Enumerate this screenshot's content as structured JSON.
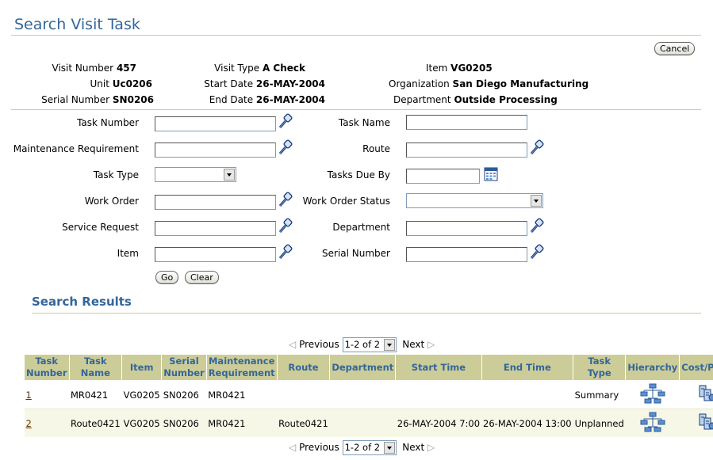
{
  "page": {
    "title": "Search Visit Task"
  },
  "buttons": {
    "cancel": "Cancel",
    "go": "Go",
    "clear": "Clear"
  },
  "header": {
    "visit_number_label": "Visit Number",
    "visit_number": "457",
    "unit_label": "Unit",
    "unit": "Uc0206",
    "serial_number_label": "Serial Number",
    "serial_number": "SN0206",
    "visit_type_label": "Visit Type",
    "visit_type": "A Check",
    "start_date_label": "Start Date",
    "start_date": "26-MAY-2004",
    "end_date_label": "End Date",
    "end_date": "26-MAY-2004",
    "item_label": "Item",
    "item": "VG0205",
    "organization_label": "Organization",
    "organization": "San Diego Manufacturing",
    "department_label": "Department",
    "department": "Outside Processing"
  },
  "form": {
    "task_number": "Task Number",
    "maintenance_requirement": "Maintenance Requirement",
    "task_type": "Task Type",
    "work_order": "Work Order",
    "service_request": "Service Request",
    "item": "Item",
    "task_name": "Task Name",
    "route": "Route",
    "tasks_due_by": "Tasks Due By",
    "work_order_status": "Work Order Status",
    "department": "Department",
    "serial_number": "Serial Number"
  },
  "results": {
    "title": "Search Results",
    "previous": "Previous",
    "next": "Next",
    "range": "1-2 of 2",
    "columns": {
      "task_number": "Task Number",
      "task_name": "Task Name",
      "item": "Item",
      "serial_number": "Serial Number",
      "maintenance_requirement": "Maintenance Requirement",
      "route": "Route",
      "department": "Department",
      "start_time": "Start Time",
      "end_time": "End Time",
      "task_type": "Task Type",
      "hierarchy": "Hierarchy",
      "cost_price": "Cost/Price"
    },
    "rows": [
      {
        "task_number": "1",
        "task_name": "MR0421",
        "item": "VG0205",
        "serial_number": "SN0206",
        "mr": "MR0421",
        "route": "",
        "department": "",
        "start_time": "",
        "end_time": "",
        "task_type": "Summary"
      },
      {
        "task_number": "2",
        "task_name": "Route0421",
        "item": "VG0205",
        "serial_number": "SN0206",
        "mr": "MR0421",
        "route": "Route0421",
        "department": "",
        "start_time": "26-MAY-2004 7:00",
        "end_time": "26-MAY-2004 13:00",
        "task_type": "Unplanned"
      }
    ]
  },
  "icons": {
    "search": "flashlight-search-icon",
    "calendar": "calendar-icon",
    "hierarchy": "hierarchy-icon",
    "cost": "cost-price-icon"
  },
  "colors": {
    "title": "#336699",
    "table_header_bg": "#cccc99",
    "link": "#663300"
  }
}
